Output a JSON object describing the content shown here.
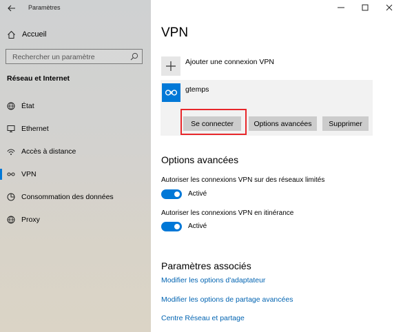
{
  "app": {
    "title": "Paramètres"
  },
  "sidebar": {
    "home_label": "Accueil",
    "search_placeholder": "Rechercher un paramètre",
    "section_title": "Réseau et Internet",
    "items": [
      {
        "label": "État",
        "icon": "status-globe-icon"
      },
      {
        "label": "Ethernet",
        "icon": "ethernet-monitor-icon"
      },
      {
        "label": "Accès à distance",
        "icon": "dial-up-icon"
      },
      {
        "label": "VPN",
        "icon": "vpn-icon",
        "selected": true
      },
      {
        "label": "Consommation des données",
        "icon": "data-usage-icon"
      },
      {
        "label": "Proxy",
        "icon": "proxy-globe-icon"
      }
    ]
  },
  "main": {
    "title": "VPN",
    "add_connection_label": "Ajouter une connexion VPN",
    "connection": {
      "name": "gtemps",
      "buttons": {
        "connect": "Se connecter",
        "advanced": "Options avancées",
        "delete": "Supprimer"
      }
    },
    "advanced_options": {
      "heading": "Options avancées",
      "metered_label": "Autoriser les connexions VPN sur des réseaux limités",
      "metered_state": "Activé",
      "roaming_label": "Autoriser les connexions VPN en itinérance",
      "roaming_state": "Activé"
    },
    "related": {
      "heading": "Paramètres associés",
      "links": [
        "Modifier les options d'adaptateur",
        "Modifier les options de partage avancées",
        "Centre Réseau et partage"
      ]
    }
  },
  "colors": {
    "accent": "#0078d7",
    "link": "#0063b1",
    "highlight": "#e8262a"
  }
}
